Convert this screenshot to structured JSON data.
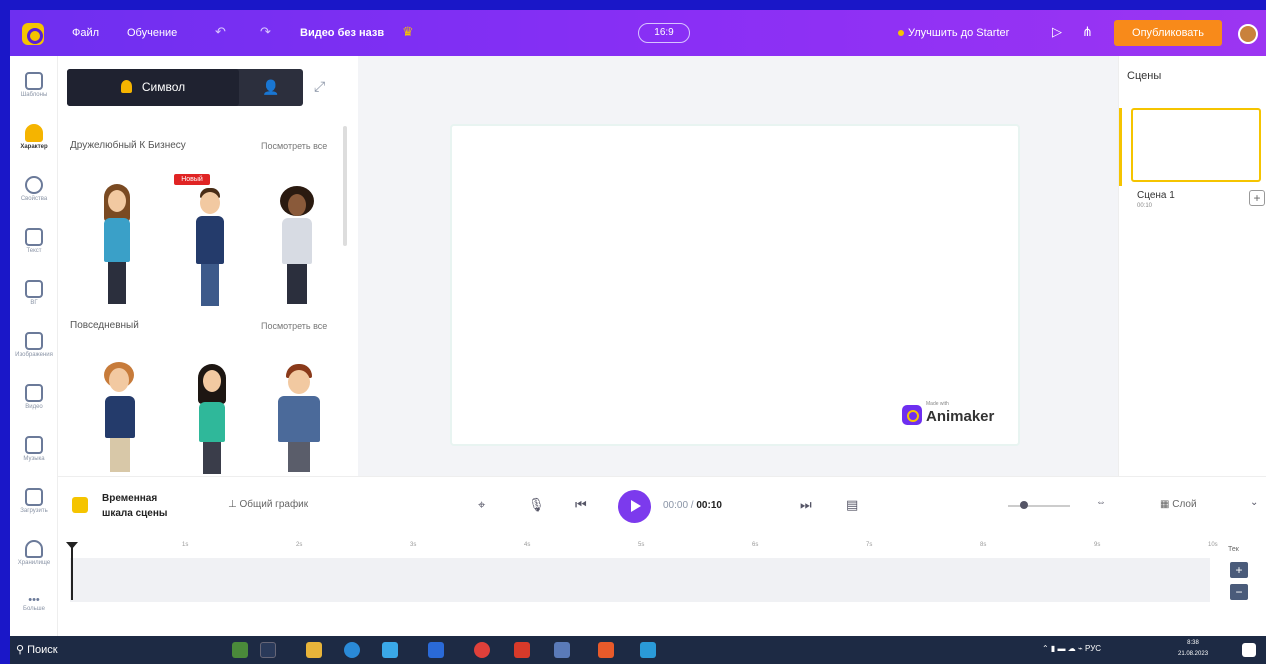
{
  "topbar": {
    "file": "Файл",
    "tutorial": "Обучение",
    "undo_icon": "undo-icon",
    "redo_icon": "redo-icon",
    "project_title": "Видео без назв",
    "ratio": "16:9",
    "upgrade": "Улучшить до Starter",
    "publish": "Опубликовать"
  },
  "leftnav": [
    {
      "icon": "template-icon",
      "label": "Шаблоны"
    },
    {
      "icon": "character-icon",
      "label": "Характер"
    },
    {
      "icon": "properties-icon",
      "label": "Свойства"
    },
    {
      "icon": "text-icon",
      "label": "Текст"
    },
    {
      "icon": "bg-icon",
      "label": "ВГ"
    },
    {
      "icon": "backgrounds-icon",
      "label": "Изображения"
    },
    {
      "icon": "video-icon",
      "label": "Видео"
    },
    {
      "icon": "music-icon",
      "label": "Музыка"
    },
    {
      "icon": "upload-icon",
      "label": "Загрузить"
    },
    {
      "icon": "cloud-icon",
      "label": "Хранилище"
    },
    {
      "icon": "more-icon",
      "label": "Больше"
    }
  ],
  "panel": {
    "tab_label": "Символ",
    "section1": "Дружелюбный К Бизнесу",
    "section2": "Повседневный",
    "see_all": "Посмотреть все",
    "badge": "Новый"
  },
  "watermark": {
    "made_with": "Made with",
    "name": "Animaker"
  },
  "scenes": {
    "title": "Сцены",
    "scene_name": "Сцена 1",
    "scene_time": "00:10"
  },
  "controls": {
    "timeline_label_1": "Временная",
    "timeline_label_2": "шкала сцены",
    "common_graph": "Общий график",
    "time_current": "00:00",
    "time_total": "00:10",
    "layout": "Слой"
  },
  "timeline": {
    "ticks": [
      "1s",
      "2s",
      "3s",
      "4s",
      "5s",
      "6s",
      "7s",
      "8s",
      "9s",
      "10s"
    ],
    "end_label": "Тек"
  },
  "taskbar": {
    "search": "Поиск",
    "lang": "РУС",
    "time": "8:38",
    "date": "21.08.2023"
  }
}
